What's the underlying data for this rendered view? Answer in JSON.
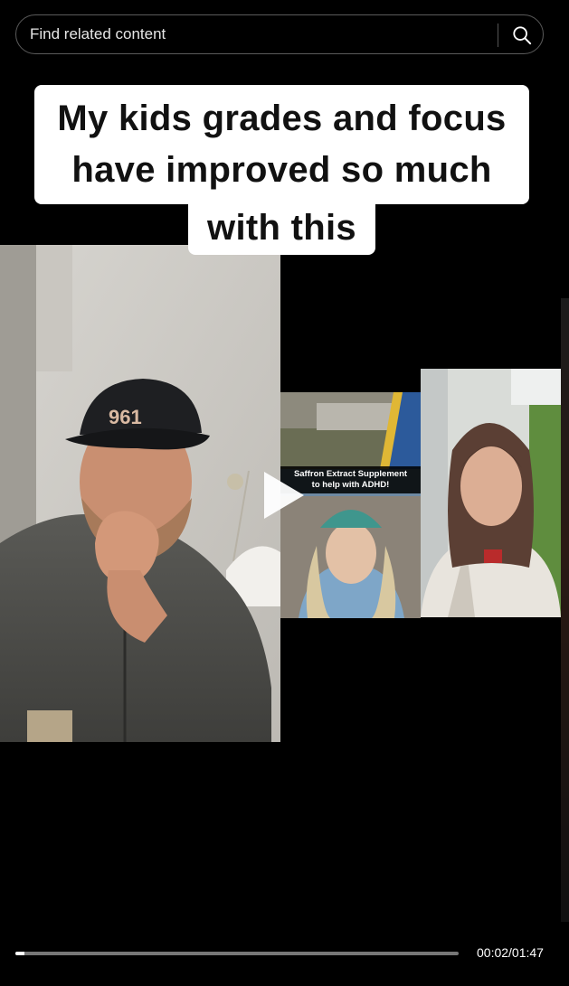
{
  "search": {
    "placeholder": "Find related content"
  },
  "video": {
    "caption_lines": [
      "My kids grades and focus",
      "have improved so much",
      "with this"
    ],
    "inset_caption_lines": [
      "Saffron Extract Supplement",
      "to help with ADHD!"
    ],
    "cap_text": "961",
    "progress": 0.02
  },
  "player": {
    "time_display": "00:02/01:47"
  },
  "colors": {
    "background": "#000000",
    "caption_bg": "#ffffff",
    "progress_fill": "#ffffff"
  }
}
